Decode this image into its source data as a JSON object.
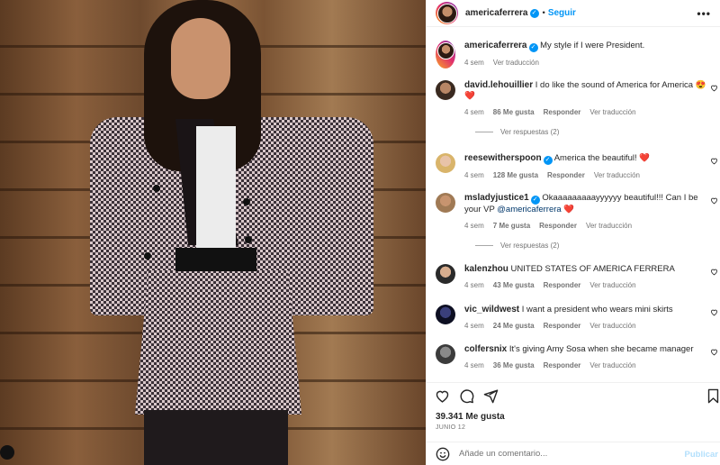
{
  "post": {
    "author": "americaferrera",
    "follow_label": "Seguir",
    "more_label": "•••",
    "caption": {
      "username": "americaferrera",
      "text": "My style if I were President.",
      "time": "4 sem",
      "translate": "Ver traducción"
    }
  },
  "comments": [
    {
      "username": "david.lehouillier",
      "verified": false,
      "text": "I do like the sound of America for America 😍",
      "extra": "❤️",
      "time": "4 sem",
      "likes": "86 Me gusta",
      "reply": "Responder",
      "translate": "Ver traducción",
      "replies": "Ver respuestas (2)"
    },
    {
      "username": "reesewitherspoon",
      "verified": true,
      "text": "America the beautiful!",
      "extra": "❤️",
      "time": "4 sem",
      "likes": "128 Me gusta",
      "reply": "Responder",
      "translate": "Ver traducción"
    },
    {
      "username": "msladyjustice1",
      "verified": true,
      "text": "Okaaaaaaaaayyyyyy beautiful!!! Can I be your VP",
      "mention": "@americaferrera",
      "extra": "❤️",
      "time": "4 sem",
      "likes": "7 Me gusta",
      "reply": "Responder",
      "translate": "Ver traducción",
      "replies": "Ver respuestas (2)"
    },
    {
      "username": "kalenzhou",
      "verified": false,
      "text": "UNITED STATES OF AMERICA FERRERA",
      "time": "4 sem",
      "likes": "43 Me gusta",
      "reply": "Responder",
      "translate": "Ver traducción"
    },
    {
      "username": "vic_wildwest",
      "verified": false,
      "text": "I want a president who wears mini skirts",
      "time": "4 sem",
      "likes": "24 Me gusta",
      "reply": "Responder",
      "translate": "Ver traducción"
    },
    {
      "username": "colfersnix",
      "verified": false,
      "text": "It's giving Amy Sosa when she became manager",
      "time": "4 sem",
      "likes": "36 Me gusta",
      "reply": "Responder",
      "translate": "Ver traducción"
    }
  ],
  "stats": {
    "likes": "39.341 Me gusta",
    "date": "JUNIO 12"
  },
  "composer": {
    "placeholder": "Añade un comentario...",
    "publish": "Publicar"
  },
  "icons": {
    "like": "heart-icon",
    "comment": "comment-icon",
    "share": "send-icon",
    "save": "bookmark-icon",
    "emoji": "emoji-icon",
    "more": "more-icon"
  },
  "colors": {
    "accent": "#0095f6",
    "heart": "#ed4956",
    "muted": "#737373",
    "text": "#262626"
  }
}
